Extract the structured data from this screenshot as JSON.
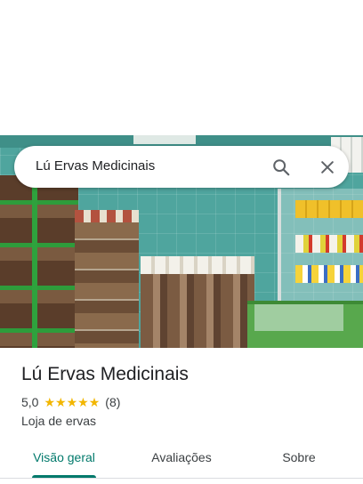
{
  "search": {
    "query": "Lú Ervas Medicinais",
    "search_icon": "search-icon",
    "close_icon": "close-icon"
  },
  "place": {
    "title": "Lú Ervas Medicinais",
    "rating": "5,0",
    "stars": [
      "★",
      "★",
      "★",
      "★",
      "★"
    ],
    "stars_value": 5,
    "review_count": "(8)",
    "category": "Loja de ervas"
  },
  "tabs": [
    {
      "label": "Visão geral",
      "active": true
    },
    {
      "label": "Avaliações",
      "active": false
    },
    {
      "label": "Sobre",
      "active": false
    }
  ],
  "colors": {
    "accent": "#00796b",
    "star": "#f2b600"
  }
}
